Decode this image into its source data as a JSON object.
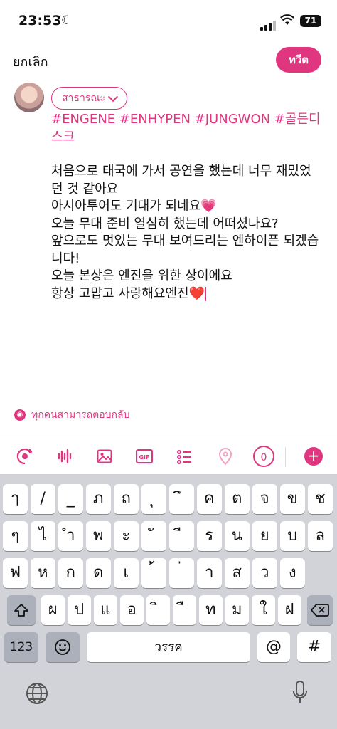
{
  "status_bar": {
    "time": "23:53",
    "battery": "71"
  },
  "header": {
    "cancel_label": "ยกเลิก",
    "post_label": "ทวีต"
  },
  "audience": {
    "label": "สาธารณะ"
  },
  "compose": {
    "hashtags": "#ENGENE #ENHYPEN #JUNGWON #골든디스크",
    "body": "처음으로 태국에 가서 공연을 했는데 너무 재밌었던 것 같아요\n아시아투어도 기대가 되네요💗\n오늘 무대 준비 열심히 했는데 어떠셨나요?\n앞으로도 멋있는 무대 보여드리는 엔하이픈 되겠습니다!\n오늘 본상은 엔진을 위한 상이에요\n항상 고맙고 사랑해요엔진❤️"
  },
  "reply_setting": {
    "label": "ทุกคนสามารถตอบกลับ"
  },
  "toolbar": {
    "icons": [
      "voice-spaces-icon",
      "audio-waveform-icon",
      "image-icon",
      "gif-icon",
      "poll-icon",
      "location-icon"
    ],
    "gif_label": "GIF",
    "char_counter": "0",
    "add_label": "+"
  },
  "keyboard": {
    "row1": [
      "ๅ",
      "/",
      "_",
      "ภ",
      "ถ",
      "ุ",
      "ึ",
      "ค",
      "ต",
      "จ",
      "ข",
      "ช"
    ],
    "row2": [
      "ๆ",
      "ไ",
      "ำ",
      "พ",
      "ะ",
      "ั",
      "ี",
      "ร",
      "น",
      "ย",
      "บ",
      "ล"
    ],
    "row3": [
      "ฟ",
      "ห",
      "ก",
      "ด",
      "เ",
      "้",
      "่",
      "า",
      "ส",
      "ว",
      "ง"
    ],
    "row4": [
      "ผ",
      "ป",
      "แ",
      "อ",
      "ิ",
      "ื",
      "ท",
      "ม",
      "ใ",
      "ฝ"
    ],
    "numbers_label": "123",
    "space_label": "วรรค",
    "at_label": "@",
    "hash_label": "#"
  }
}
